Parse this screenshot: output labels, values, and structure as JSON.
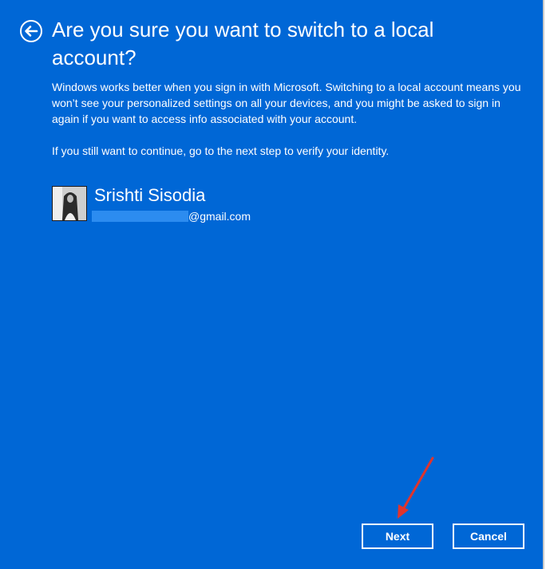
{
  "dialog": {
    "title": "Are you sure you want to switch to a local account?",
    "paragraph_1": "Windows works better when you sign in with Microsoft. Switching to a local account means you won’t see your personalized settings on all your devices, and you might be asked to sign in again if you want to access info associated with your account.",
    "paragraph_2": "If you still want to continue, go to the next step to verify your identity."
  },
  "account": {
    "name": "Srishti Sisodia",
    "email_domain": "@gmail.com"
  },
  "buttons": {
    "next_label": "Next",
    "cancel_label": "Cancel"
  },
  "icons": {
    "back": "back-arrow-circle-icon",
    "annotation": "red-pointer-arrow"
  },
  "colors": {
    "background": "#0067d6",
    "text": "#ffffff",
    "annotation_arrow": "#e0342c",
    "email_redaction": "#2c8cf0"
  }
}
